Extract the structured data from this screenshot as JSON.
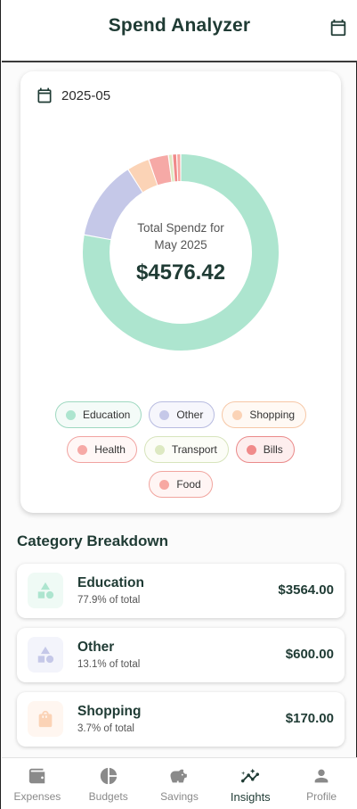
{
  "app": {
    "title": "Spend Analyzer",
    "accent": "#1f3b34"
  },
  "summary": {
    "month": "2025-05",
    "center_label": "Total Spendz for May 2025",
    "center_value": "$4576.42"
  },
  "chart_data": {
    "type": "pie",
    "categories": [
      "Education",
      "Other",
      "Shopping",
      "Health",
      "Transport",
      "Bills",
      "Food"
    ],
    "values": [
      3564.0,
      600.0,
      170.0,
      150.0,
      30.0,
      32.42,
      30.0
    ],
    "colors": [
      "#ade5cf",
      "#c5c8e8",
      "#fbd3b6",
      "#f6a9a6",
      "#dde9c2",
      "#f08a8a",
      "#f7a8a2"
    ],
    "legend_position": "bottom"
  },
  "legend": {
    "items": [
      {
        "label": "Education",
        "color": "#ade5cf",
        "border": "#9ed8c0",
        "bg": "#f4fbf8"
      },
      {
        "label": "Other",
        "color": "#c5c8e8",
        "border": "#b7bbe0",
        "bg": "#f6f6fc"
      },
      {
        "label": "Shopping",
        "color": "#fbd3b6",
        "border": "#f6c7a6",
        "bg": "#fff9f4"
      },
      {
        "label": "Health",
        "color": "#f6a9a6",
        "border": "#f1a3a0",
        "bg": "#fff7f6"
      },
      {
        "label": "Transport",
        "color": "#dde9c2",
        "border": "#d7e4bc",
        "bg": "#fcfdf7"
      },
      {
        "label": "Bills",
        "color": "#f08a8a",
        "border": "#ea8a8a",
        "bg": "#fdeeee"
      },
      {
        "label": "Food",
        "color": "#f7a8a2",
        "border": "#f1a59f",
        "bg": "#fff5f4"
      }
    ]
  },
  "breakdown": {
    "title": "Category Breakdown",
    "items": [
      {
        "name": "Education",
        "pct": "77.9% of total",
        "amount": "$3564.00",
        "icon": "shapes-icon",
        "color": "#ade5cf",
        "bg": "#effaf5"
      },
      {
        "name": "Other",
        "pct": "13.1% of total",
        "amount": "$600.00",
        "icon": "shapes-icon",
        "color": "#c5c8e8",
        "bg": "#f3f4fb"
      },
      {
        "name": "Shopping",
        "pct": "3.7% of total",
        "amount": "$170.00",
        "icon": "shopping-bag-icon",
        "color": "#fbd3b6",
        "bg": "#fff6f0"
      }
    ]
  },
  "nav": {
    "items": [
      {
        "label": "Expenses",
        "icon": "wallet-icon",
        "active": false
      },
      {
        "label": "Budgets",
        "icon": "pie-chart-icon",
        "active": false
      },
      {
        "label": "Savings",
        "icon": "piggy-bank-icon",
        "active": false
      },
      {
        "label": "Insights",
        "icon": "insights-icon",
        "active": true
      },
      {
        "label": "Profile",
        "icon": "person-icon",
        "active": false
      }
    ]
  }
}
